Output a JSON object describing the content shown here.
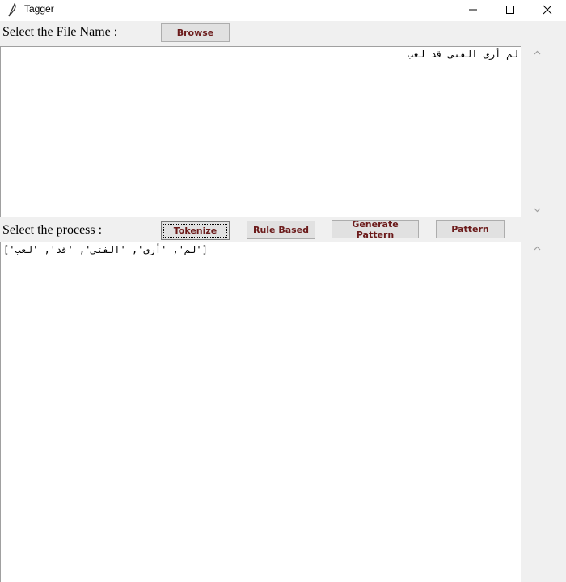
{
  "window": {
    "title": "Tagger"
  },
  "file_row": {
    "label": "Select the File Name :",
    "browse_label": "Browse"
  },
  "input_text": "لم أرى الفتى قد لعب",
  "process_row": {
    "label": "Select the process :",
    "buttons": [
      "Tokenize",
      "Rule Based",
      "Generate Pattern",
      "Pattern"
    ]
  },
  "output_text": "['لم', 'أرى', 'الفتى', 'قد', 'لعب']"
}
